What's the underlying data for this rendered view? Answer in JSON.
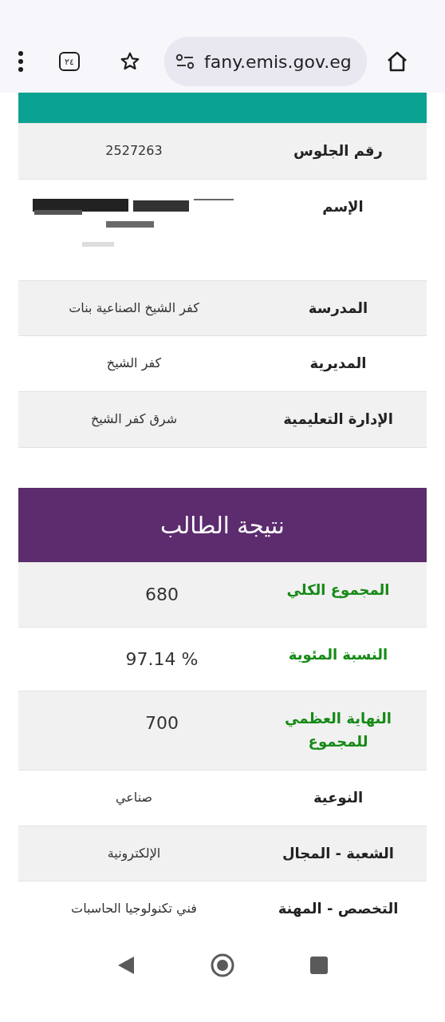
{
  "browser": {
    "tab_count": "٢٤",
    "url": "fany.emis.gov.eg"
  },
  "student_info": {
    "rows": [
      {
        "label": "رقم الجلوس",
        "value": "2527263",
        "kind": "text"
      },
      {
        "label": "الإسم",
        "kind": "redacted"
      },
      {
        "label": "المدرسة",
        "value": "كفر الشيخ الصناعية بنات",
        "kind": "text"
      },
      {
        "label": "المديرية",
        "value": "كفر الشيخ",
        "kind": "text"
      },
      {
        "label": "الإدارة التعليمية",
        "value": "شرق كفر الشيخ",
        "kind": "text"
      }
    ]
  },
  "result": {
    "title": "نتيجة الطالب",
    "rows": [
      {
        "label": "المجموع الكلي",
        "value": "680",
        "color": "#168a16",
        "kind": "score"
      },
      {
        "label": "النسبة المئوية",
        "value": "% 97.14",
        "color": "#168a16",
        "kind": "score"
      },
      {
        "label": "النهاية العظمي للمجموع",
        "value": "700",
        "color": "#168a16",
        "kind": "score"
      },
      {
        "label": "النوعية",
        "value": "صناعي",
        "color": "#222222",
        "kind": "text"
      },
      {
        "label": "الشعبة - المجال",
        "value": "الإلكترونية",
        "color": "#222222",
        "kind": "text"
      },
      {
        "label": "التخصص - المهنة",
        "value": "فني تكنولوجيا الحاسبات",
        "color": "#222222",
        "kind": "text"
      }
    ]
  }
}
